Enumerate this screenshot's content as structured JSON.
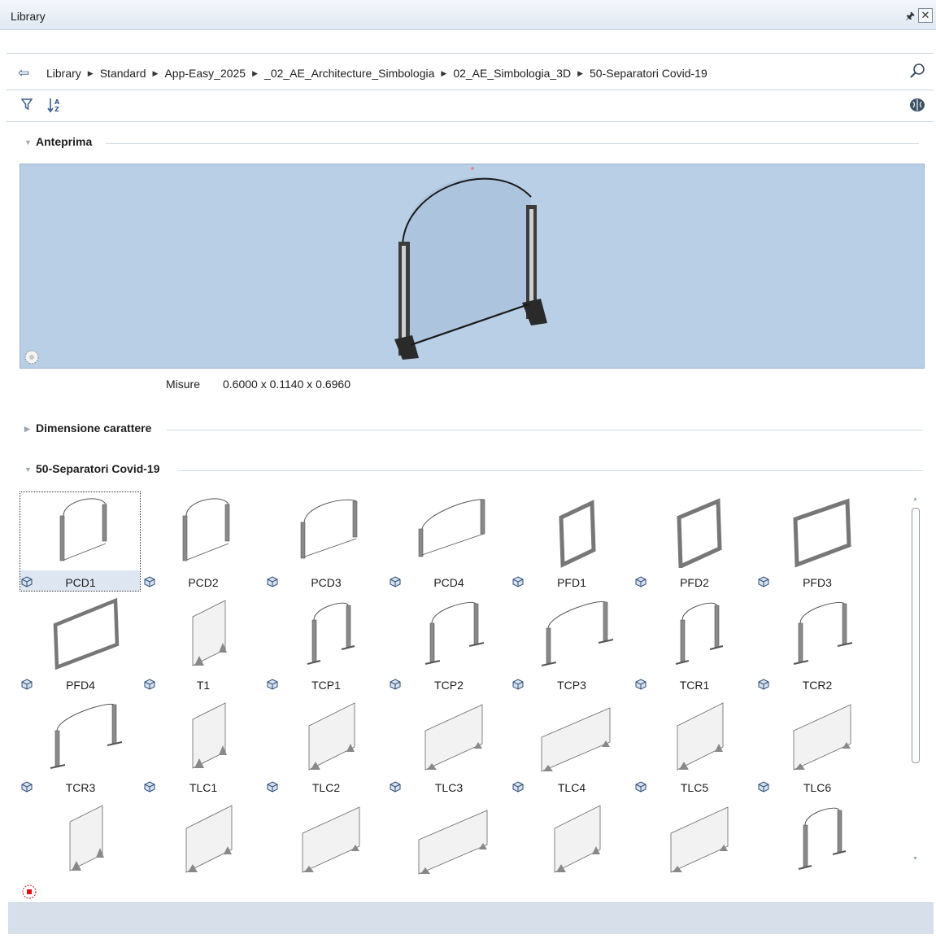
{
  "window": {
    "title": "Library"
  },
  "breadcrumb": {
    "items": [
      "Library",
      "Standard",
      "App-Easy_2025",
      "_02_AE_Architecture_Simbologia",
      "02_AE_Simbologia_3D",
      "50-Separatori Covid-19"
    ]
  },
  "sections": {
    "preview_title": "Anteprima",
    "dimension_title": "Dimensione carattere",
    "group_title": "50-Separatori Covid-19"
  },
  "preview": {
    "measure_label": "Misure",
    "measure_value": "0.6000 x 0.1140 x 0.6960"
  },
  "items": [
    {
      "label": "PCD1",
      "shape": "arch-left",
      "selected": true
    },
    {
      "label": "PCD2",
      "shape": "arch-left"
    },
    {
      "label": "PCD3",
      "shape": "arch-wide"
    },
    {
      "label": "PCD4",
      "shape": "arch-wider"
    },
    {
      "label": "PFD1",
      "shape": "frame-narrow"
    },
    {
      "label": "PFD2",
      "shape": "frame-mid"
    },
    {
      "label": "PFD3",
      "shape": "frame-wide"
    },
    {
      "label": "PFD4",
      "shape": "frame-wider"
    },
    {
      "label": "T1",
      "shape": "table-panel"
    },
    {
      "label": "TCP1",
      "shape": "stand-narrow"
    },
    {
      "label": "TCP2",
      "shape": "stand-mid"
    },
    {
      "label": "TCP3",
      "shape": "stand-wide"
    },
    {
      "label": "TCR1",
      "shape": "stand-narrow"
    },
    {
      "label": "TCR2",
      "shape": "stand-mid"
    },
    {
      "label": "TCR3",
      "shape": "stand-wide"
    },
    {
      "label": "TLC1",
      "shape": "table-panel"
    },
    {
      "label": "TLC2",
      "shape": "table-mid"
    },
    {
      "label": "TLC3",
      "shape": "table-wide"
    },
    {
      "label": "TLC4",
      "shape": "table-wider"
    },
    {
      "label": "TLC5",
      "shape": "table-mid"
    },
    {
      "label": "TLC6",
      "shape": "table-wide"
    },
    {
      "label": "",
      "shape": "table-panel"
    },
    {
      "label": "",
      "shape": "table-mid"
    },
    {
      "label": "",
      "shape": "table-wide"
    },
    {
      "label": "",
      "shape": "table-wider"
    },
    {
      "label": "",
      "shape": "table-mid"
    },
    {
      "label": "",
      "shape": "table-wide"
    },
    {
      "label": "",
      "shape": "stand-narrow"
    }
  ],
  "colors": {
    "accent": "#3b5b8c",
    "preview_bg": "#b9cfe6",
    "selection": "#dde6f1"
  }
}
